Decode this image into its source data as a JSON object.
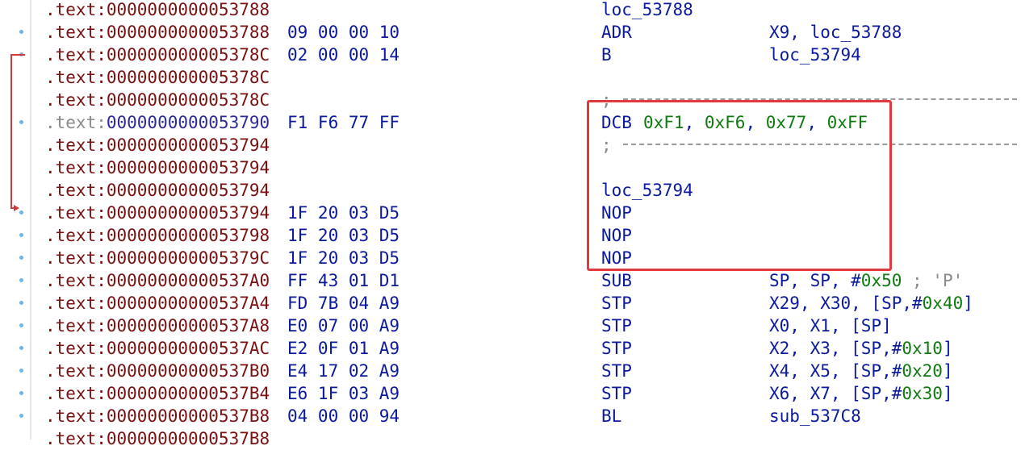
{
  "lines": [
    {
      "addr": ".text:0000000000053788",
      "bytes": "",
      "mnem": "loc_53788",
      "ops": []
    },
    {
      "addr": ".text:0000000000053788",
      "bytes": "09 00 00 10",
      "mnem": "ADR",
      "ops": [
        {
          "t": "X9, loc_53788",
          "c": "reg"
        }
      ]
    },
    {
      "addr": ".text:000000000005378C",
      "bytes": "02 00 00 14",
      "mnem": "B",
      "ops": [
        {
          "t": "loc_53794",
          "c": "reg"
        }
      ]
    },
    {
      "addr": ".text:000000000005378C",
      "bytes": "",
      "mnem": "",
      "ops": []
    },
    {
      "addr": ".text:000000000005378C",
      "bytes": "",
      "mnem": ";",
      "ops": [],
      "separator": true
    },
    {
      "addr_prefix": ".text:",
      "addr_offset": "0000000000053790",
      "gray": true,
      "bytes": "F1 F6 77 FF",
      "mnem": "DCB",
      "ops": [
        {
          "t": "0xF1",
          "c": "num"
        },
        {
          "t": ", ",
          "c": "reg"
        },
        {
          "t": "0xF6",
          "c": "num"
        },
        {
          "t": ", ",
          "c": "reg"
        },
        {
          "t": "0x77",
          "c": "num"
        },
        {
          "t": ", ",
          "c": "reg"
        },
        {
          "t": "0xFF",
          "c": "num"
        }
      ],
      "inline_ops": true
    },
    {
      "addr": ".text:0000000000053794",
      "bytes": "",
      "mnem": ";",
      "ops": [],
      "separator": true
    },
    {
      "addr": ".text:0000000000053794",
      "bytes": "",
      "mnem": "",
      "ops": []
    },
    {
      "addr": ".text:0000000000053794",
      "bytes": "",
      "mnem": "loc_53794",
      "ops": []
    },
    {
      "addr": ".text:0000000000053794",
      "bytes": "1F 20 03 D5",
      "mnem": "NOP",
      "ops": []
    },
    {
      "addr": ".text:0000000000053798",
      "bytes": "1F 20 03 D5",
      "mnem": "NOP",
      "ops": []
    },
    {
      "addr": ".text:000000000005379C",
      "bytes": "1F 20 03 D5",
      "mnem": "NOP",
      "ops": []
    },
    {
      "addr": ".text:00000000000537A0",
      "bytes": "FF 43 01 D1",
      "mnem": "SUB",
      "ops": [
        {
          "t": "SP, SP, #",
          "c": "reg"
        },
        {
          "t": "0x50",
          "c": "num"
        },
        {
          "t": " ; 'P'",
          "c": "cmt"
        }
      ]
    },
    {
      "addr": ".text:00000000000537A4",
      "bytes": "FD 7B 04 A9",
      "mnem": "STP",
      "ops": [
        {
          "t": "X29, X30, [SP,#",
          "c": "reg"
        },
        {
          "t": "0x40",
          "c": "num"
        },
        {
          "t": "]",
          "c": "reg"
        }
      ]
    },
    {
      "addr": ".text:00000000000537A8",
      "bytes": "E0 07 00 A9",
      "mnem": "STP",
      "ops": [
        {
          "t": "X0, X1, [SP]",
          "c": "reg"
        }
      ]
    },
    {
      "addr": ".text:00000000000537AC",
      "bytes": "E2 0F 01 A9",
      "mnem": "STP",
      "ops": [
        {
          "t": "X2, X3, [SP,#",
          "c": "reg"
        },
        {
          "t": "0x10",
          "c": "num"
        },
        {
          "t": "]",
          "c": "reg"
        }
      ]
    },
    {
      "addr": ".text:00000000000537B0",
      "bytes": "E4 17 02 A9",
      "mnem": "STP",
      "ops": [
        {
          "t": "X4, X5, [SP,#",
          "c": "reg"
        },
        {
          "t": "0x20",
          "c": "num"
        },
        {
          "t": "]",
          "c": "reg"
        }
      ]
    },
    {
      "addr": ".text:00000000000537B4",
      "bytes": "E6 1F 03 A9",
      "mnem": "STP",
      "ops": [
        {
          "t": "X6, X7, [SP,#",
          "c": "reg"
        },
        {
          "t": "0x30",
          "c": "num"
        },
        {
          "t": "]",
          "c": "reg"
        }
      ]
    },
    {
      "addr": ".text:00000000000537B8",
      "bytes": "04 00 00 94",
      "mnem": "BL",
      "ops": [
        {
          "t": "sub_537C8",
          "c": "reg"
        }
      ]
    },
    {
      "addr": ".text:00000000000537B8",
      "bytes": "",
      "mnem": "",
      "ops": []
    }
  ],
  "dots": [
    1,
    2,
    5,
    9,
    10,
    11,
    12,
    13,
    14,
    15,
    16,
    17,
    18
  ],
  "colors": {
    "address": "#7a1010",
    "bytes_and_mnemonics": "#0a1a9a",
    "numbers": "#107a10",
    "comments": "#8a8a8a",
    "highlight_box": "#e0393e",
    "jump_arrow": "#d23b3b",
    "gutter_dot": "#6fb3e0"
  },
  "icons": {
    "breakpoint_dot": "blue-dot-icon",
    "jump_arrow": "branch-arrow-icon"
  }
}
